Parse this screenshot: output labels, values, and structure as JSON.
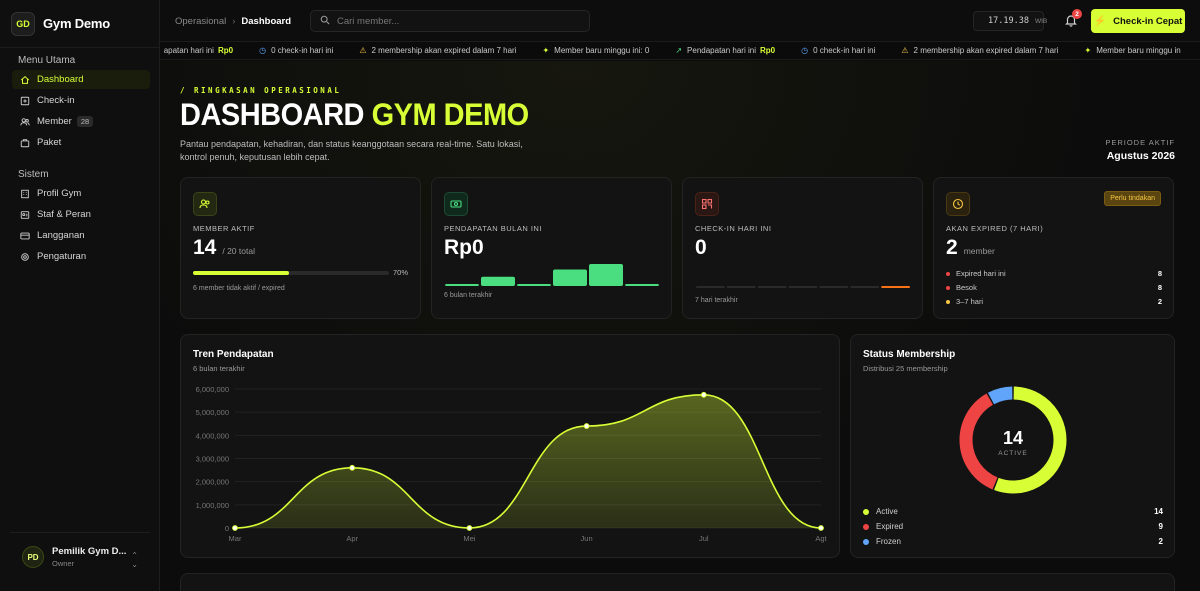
{
  "brand": {
    "logo": "GD",
    "name": "Gym Demo"
  },
  "sidebar": {
    "section_main": "Menu Utama",
    "main_items": [
      {
        "label": "Dashboard",
        "icon": "home-icon",
        "active": true
      },
      {
        "label": "Check-in",
        "icon": "checkin-icon"
      },
      {
        "label": "Member",
        "icon": "users-icon",
        "badge": "28"
      },
      {
        "label": "Paket",
        "icon": "package-icon"
      }
    ],
    "section_system": "Sistem",
    "system_items": [
      {
        "label": "Profil Gym",
        "icon": "building-icon"
      },
      {
        "label": "Staf & Peran",
        "icon": "staff-icon"
      },
      {
        "label": "Langganan",
        "icon": "card-icon"
      },
      {
        "label": "Pengaturan",
        "icon": "gear-icon"
      }
    ],
    "user": {
      "initials": "PD",
      "name": "Pemilik Gym D...",
      "role": "Owner"
    }
  },
  "topbar": {
    "breadcrumb_parent": "Operasional",
    "breadcrumb_current": "Dashboard",
    "search_placeholder": "Cari member...",
    "clock": "17.19.38",
    "timezone": "WIB",
    "notif_count": "2",
    "quick_checkin": "Check-in Cepat"
  },
  "ticker": [
    {
      "icon": "trend-icon",
      "text": "apatan hari ini",
      "highlight": "Rp0"
    },
    {
      "icon": "checkin-icon",
      "text": "0 check-in hari ini"
    },
    {
      "icon": "warning-icon",
      "text": "2 membership akan expired dalam 7 hari"
    },
    {
      "icon": "sparkle-icon",
      "text": "Member baru minggu ini: 0"
    },
    {
      "icon": "trend-icon",
      "text": "Pendapatan hari ini",
      "highlight": "Rp0"
    },
    {
      "icon": "checkin-icon",
      "text": "0 check-in hari ini"
    },
    {
      "icon": "warning-icon",
      "text": "2 membership akan expired dalam 7 hari"
    },
    {
      "icon": "sparkle-icon",
      "text": "Member baru minggu in"
    }
  ],
  "hero": {
    "eyebrow": "/ RINGKASAN OPERASIONAL",
    "title_a": "DASHBOARD",
    "title_b": "GYM DEMO",
    "description": "Pantau pendapatan, kehadiran, dan status keanggotaan secara real-time. Satu lokasi, kontrol penuh, keputusan lebih cepat.",
    "period_label": "PERIODE AKTIF",
    "period_value": "Agustus 2026"
  },
  "kpi": {
    "members": {
      "label": "MEMBER AKTIF",
      "value": "14",
      "sub": "/ 20 total",
      "progress": 0.7,
      "progress_label": "70%",
      "footer": "6 member tidak aktif / expired"
    },
    "revenue": {
      "label": "PENDAPATAN BULAN INI",
      "value": "Rp0",
      "footer": "6 bulan terakhir",
      "bars": [
        0,
        0.42,
        0,
        0.75,
        1,
        0
      ]
    },
    "checkin": {
      "label": "CHECK-IN HARI INI",
      "value": "0",
      "footer": "7 hari terakhir",
      "bars": [
        0,
        0,
        0,
        0,
        0,
        0,
        0
      ]
    },
    "expiring": {
      "label": "AKAN EXPIRED (7 HARI)",
      "value": "2",
      "sub": "member",
      "alert": "Perlu tindakan",
      "rows": [
        {
          "label": "Expired hari ini",
          "value": "8",
          "color": "#ef4444"
        },
        {
          "label": "Besok",
          "value": "8",
          "color": "#ef4444"
        },
        {
          "label": "3–7 hari",
          "value": "2",
          "color": "#f5c542"
        }
      ]
    }
  },
  "revenue_chart": {
    "title": "Tren Pendapatan",
    "subtitle": "6 bulan terakhir",
    "accent": "#d8ff36"
  },
  "membership_chart": {
    "title": "Status Membership",
    "subtitle": "Distribusi 25 membership",
    "center_value": "14",
    "center_label": "ACTIVE"
  },
  "chart_data": [
    {
      "type": "area",
      "title": "Tren Pendapatan",
      "categories": [
        "Mar",
        "Apr",
        "Mei",
        "Jun",
        "Jul",
        "Agt"
      ],
      "values": [
        0,
        2600000,
        0,
        4400000,
        5750000,
        0
      ],
      "yticks": [
        "0",
        "1,000,000",
        "2,000,000",
        "3,000,000",
        "4,000,000",
        "5,000,000",
        "6,000,000"
      ],
      "ylim": [
        0,
        6000000
      ],
      "grid": true
    },
    {
      "type": "pie",
      "title": "Status Membership",
      "series": [
        {
          "name": "Active",
          "value": 14,
          "color": "#d8ff36"
        },
        {
          "name": "Expired",
          "value": 9,
          "color": "#ef4444"
        },
        {
          "name": "Frozen",
          "value": 2,
          "color": "#60a5fa"
        }
      ]
    }
  ]
}
